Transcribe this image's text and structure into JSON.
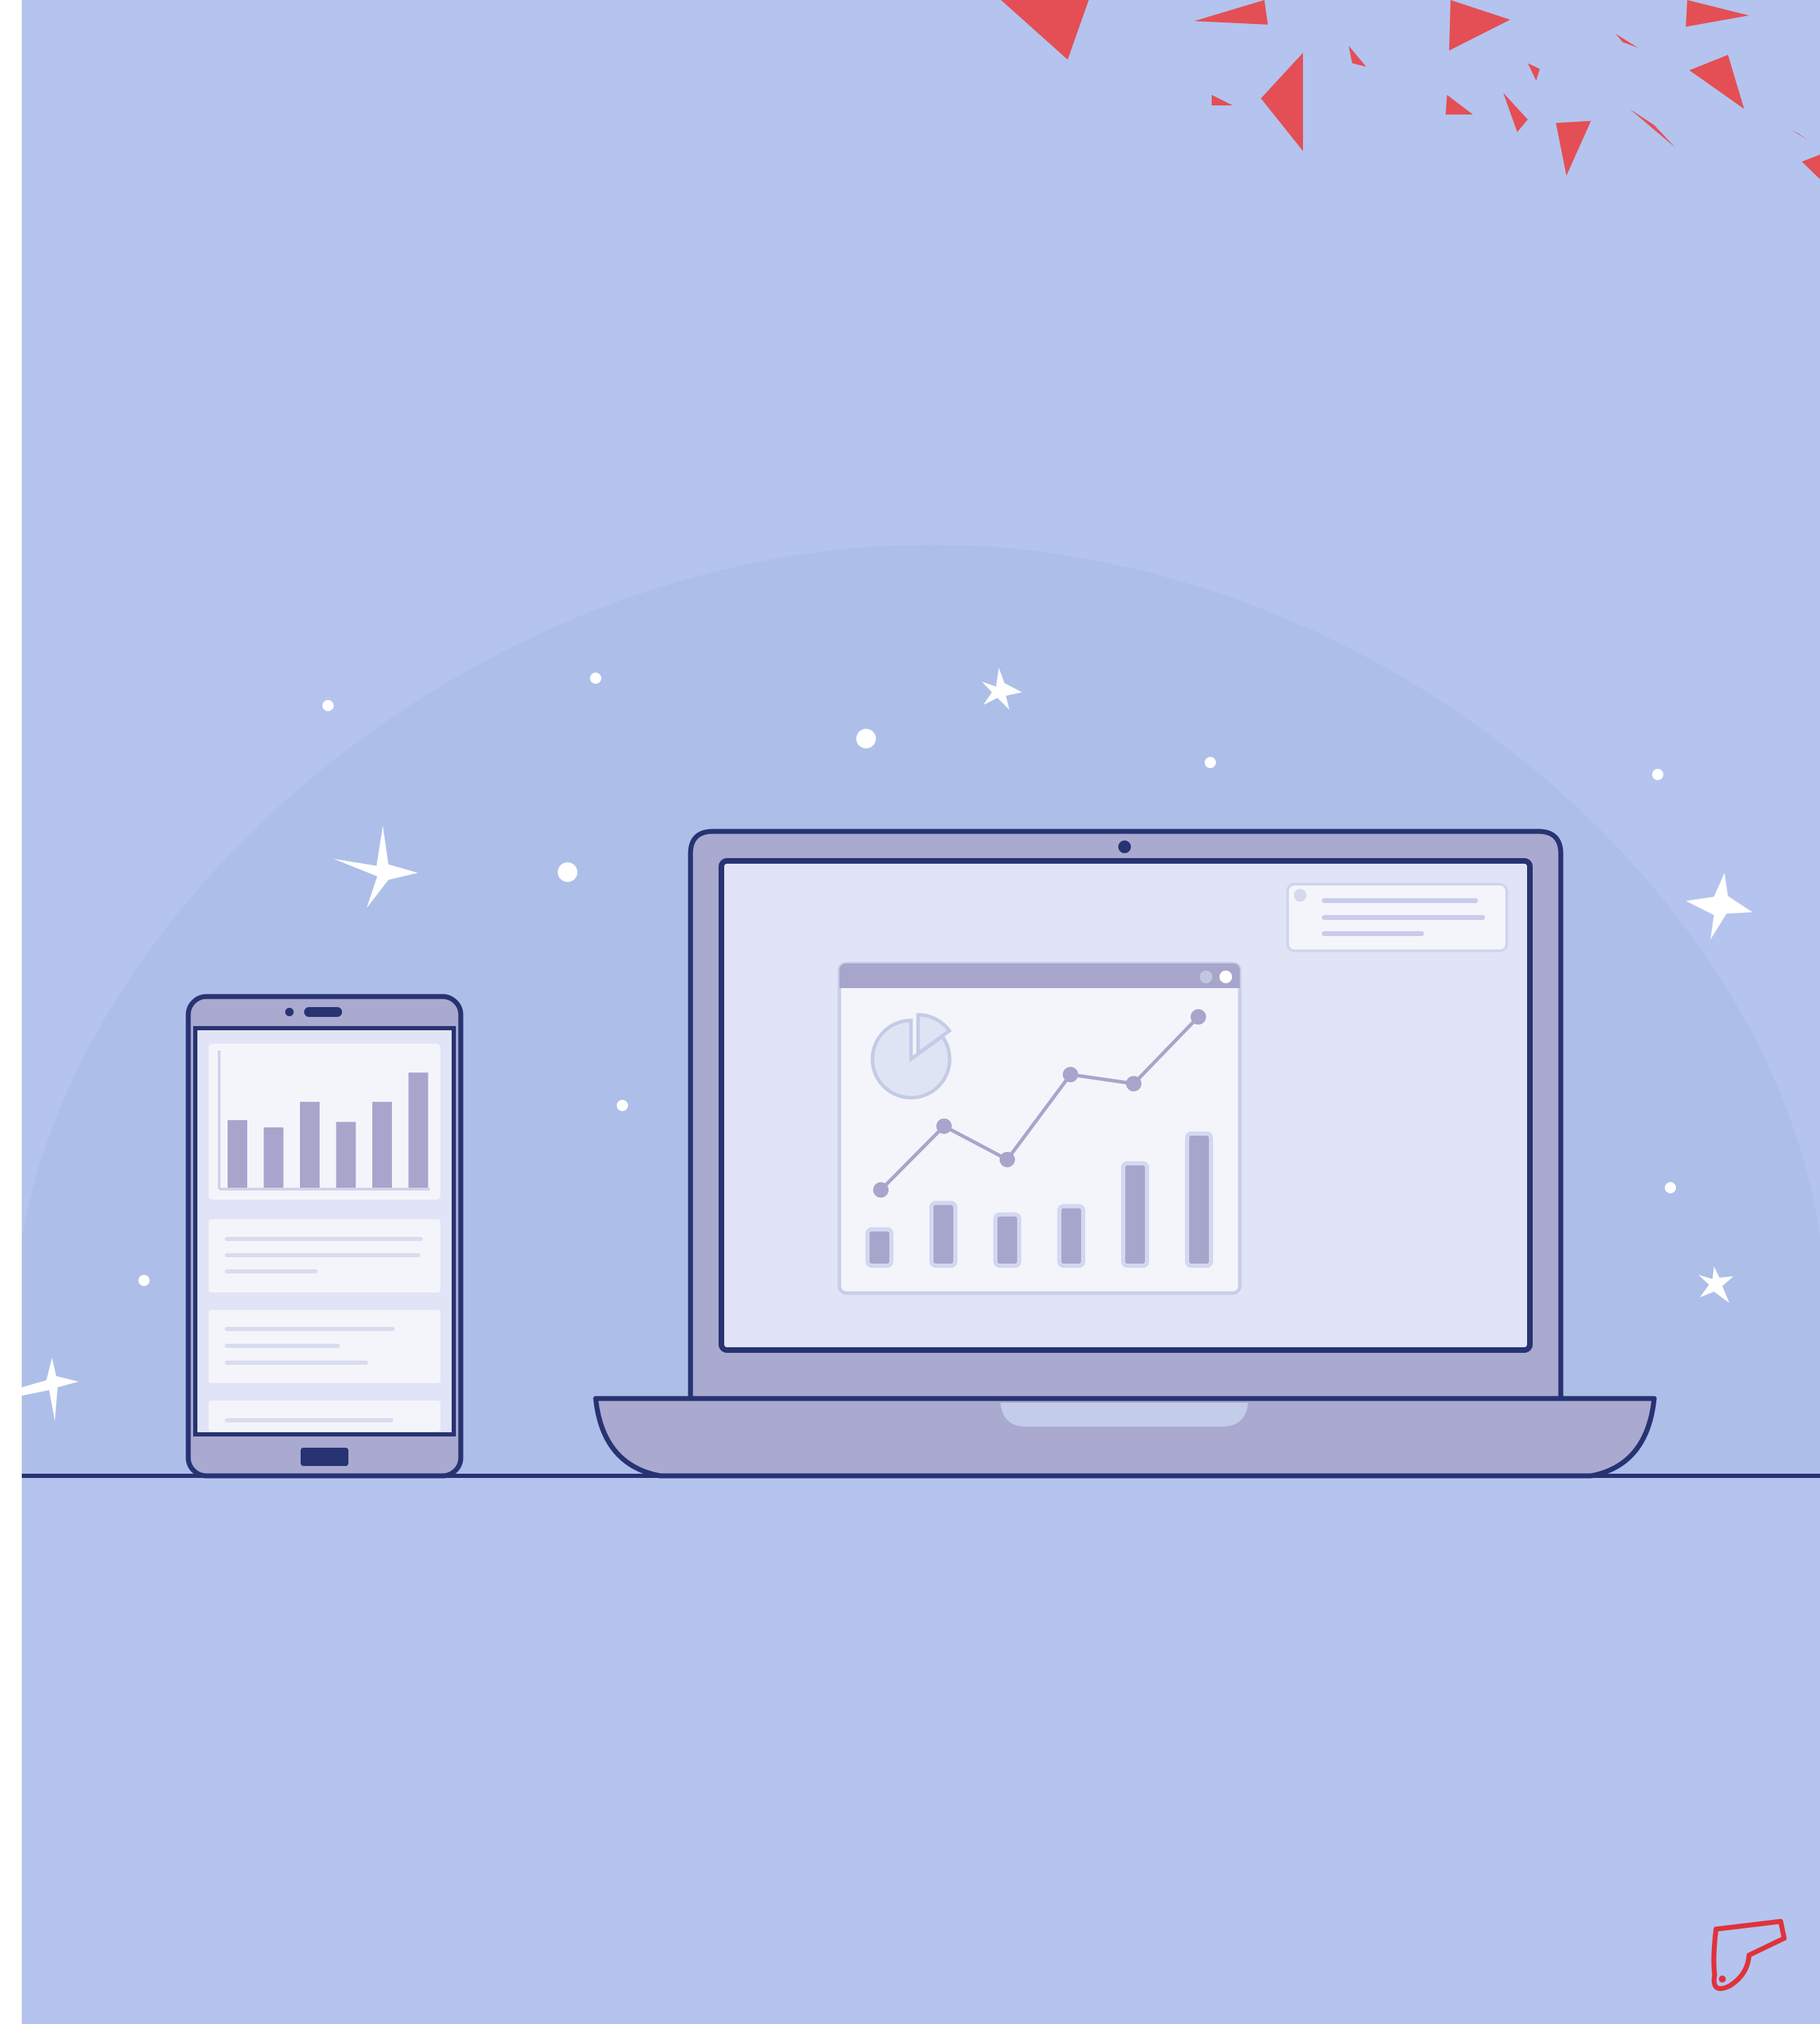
{
  "colors": {
    "background": "#b4c4ee",
    "halo": "#adbfe8",
    "outline": "#273372",
    "device_body": "#aaa9d0",
    "screen": "#e0e4f6",
    "panel": "#f4f5fb",
    "accent_bar": "#a7a5cb",
    "divider": "#d8dcef",
    "sparkle": "#ffffff",
    "confetti": "#e34f55",
    "logo": "#e0323b"
  },
  "illustration": {
    "phone_chart_bars": [
      0.37,
      0.33,
      0.47,
      0.36,
      0.47,
      0.63
    ],
    "laptop_chart_bars": [
      0.22,
      0.38,
      0.31,
      0.36,
      0.62,
      0.8
    ],
    "laptop_line_points": [
      0.12,
      0.33,
      0.22,
      0.5,
      0.47,
      0.69
    ],
    "pie_slices": [
      0.85,
      0.15
    ]
  },
  "icons": {
    "logo": "whistle-logo-icon",
    "sparkle": "four-point-star-icon",
    "confetti": "triangle-confetti-icon"
  }
}
